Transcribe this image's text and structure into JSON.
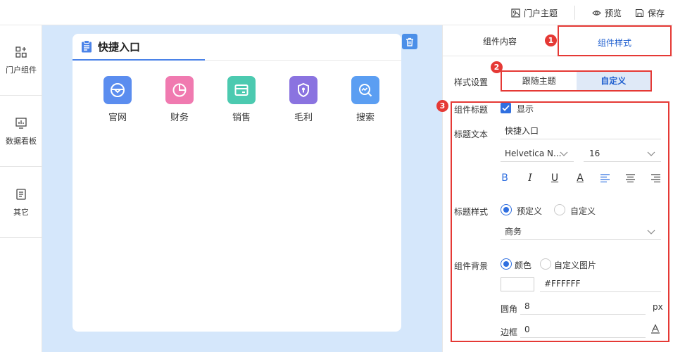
{
  "topbar": {
    "portal_theme": "门户主题",
    "preview": "预览",
    "save": "保存"
  },
  "sidebar": {
    "items": [
      {
        "label": "门户组件",
        "icon": "components-icon"
      },
      {
        "label": "数据看板",
        "icon": "dashboard-icon"
      },
      {
        "label": "其它",
        "icon": "document-icon"
      }
    ]
  },
  "card": {
    "title": "快捷入口",
    "entries": [
      {
        "label": "官网",
        "icon": "steering-wheel-icon",
        "color": "#5b8def"
      },
      {
        "label": "财务",
        "icon": "pie-chart-icon",
        "color": "#f07ab0"
      },
      {
        "label": "销售",
        "icon": "card-icon",
        "color": "#4ccab0"
      },
      {
        "label": "毛利",
        "icon": "shield-icon",
        "color": "#8a73e0"
      },
      {
        "label": "搜索",
        "icon": "search-chart-icon",
        "color": "#5b9ef2"
      }
    ]
  },
  "panel": {
    "tabs": [
      "组件内容",
      "组件样式"
    ],
    "active_tab": "组件样式",
    "badges": [
      "1",
      "2",
      "3"
    ],
    "style_setting": {
      "label": "样式设置",
      "options": [
        "跟随主题",
        "自定义"
      ],
      "selected": "自定义"
    },
    "title_section": {
      "label": "组件标题",
      "show_label": "显示",
      "show_checked": true,
      "text_label": "标题文本",
      "text_value": "快捷入口",
      "font_family": "Helvetica N...",
      "font_size": "16",
      "format_buttons": [
        "B",
        "I",
        "U",
        "A",
        "align-left",
        "align-center",
        "align-right"
      ]
    },
    "title_style": {
      "label": "标题样式",
      "options": [
        "预定义",
        "自定义"
      ],
      "selected": "预定义",
      "preset_value": "商务"
    },
    "background": {
      "label": "组件背景",
      "options": [
        "颜色",
        "自定义图片"
      ],
      "selected": "颜色",
      "color_hex": "#FFFFFF",
      "radius_label": "圆角",
      "radius_value": "8",
      "radius_unit": "px",
      "border_label": "边框",
      "border_value": "0"
    }
  },
  "colors": {
    "accent": "#2f6fe0",
    "highlight_red": "#e53935",
    "canvas_bg": "#d5e7fb"
  }
}
